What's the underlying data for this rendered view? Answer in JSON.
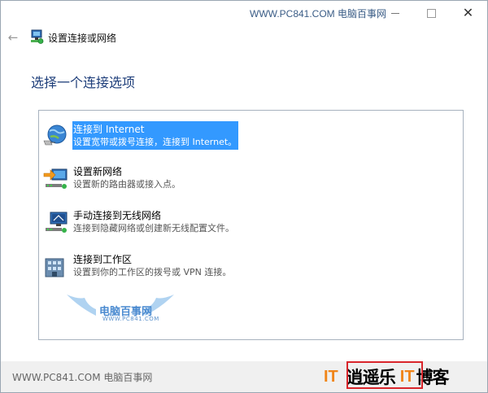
{
  "titlebar": {
    "watermark": "WWW.PC841.COM 电脑百事网",
    "minimize_icon": "minimize-icon",
    "maximize_icon": "maximize-icon",
    "close_icon": "close-icon",
    "close_glyph": "✕"
  },
  "nav": {
    "back_glyph": "←",
    "title": "设置连接或网络"
  },
  "heading": "选择一个连接选项",
  "options": [
    {
      "title": "连接到 Internet",
      "desc": "设置宽带或拨号连接，连接到 Internet。",
      "icon": "globe-internet-icon",
      "selected": true
    },
    {
      "title": "设置新网络",
      "desc": "设置新的路由器或接入点。",
      "icon": "new-network-icon",
      "selected": false
    },
    {
      "title": "手动连接到无线网络",
      "desc": "连接到隐藏网络或创建新无线配置文件。",
      "icon": "wireless-network-icon",
      "selected": false
    },
    {
      "title": "连接到工作区",
      "desc": "设置到你的工作区的拨号或 VPN 连接。",
      "icon": "workplace-icon",
      "selected": false
    }
  ],
  "list_watermark": {
    "name": "电脑百事网",
    "url": "WWW.PC841.COM"
  },
  "footer": {
    "watermark": "WWW.PC841.COM 电脑百事网",
    "brand_it1": "IT",
    "brand_main1": "逍遥乐",
    "brand_it2": "IT",
    "brand_main2": "博客"
  },
  "colors": {
    "selection": "#3399ff",
    "heading": "#1e3e7a",
    "brand_orange": "#f08519",
    "highlight_box": "#d9252b"
  }
}
